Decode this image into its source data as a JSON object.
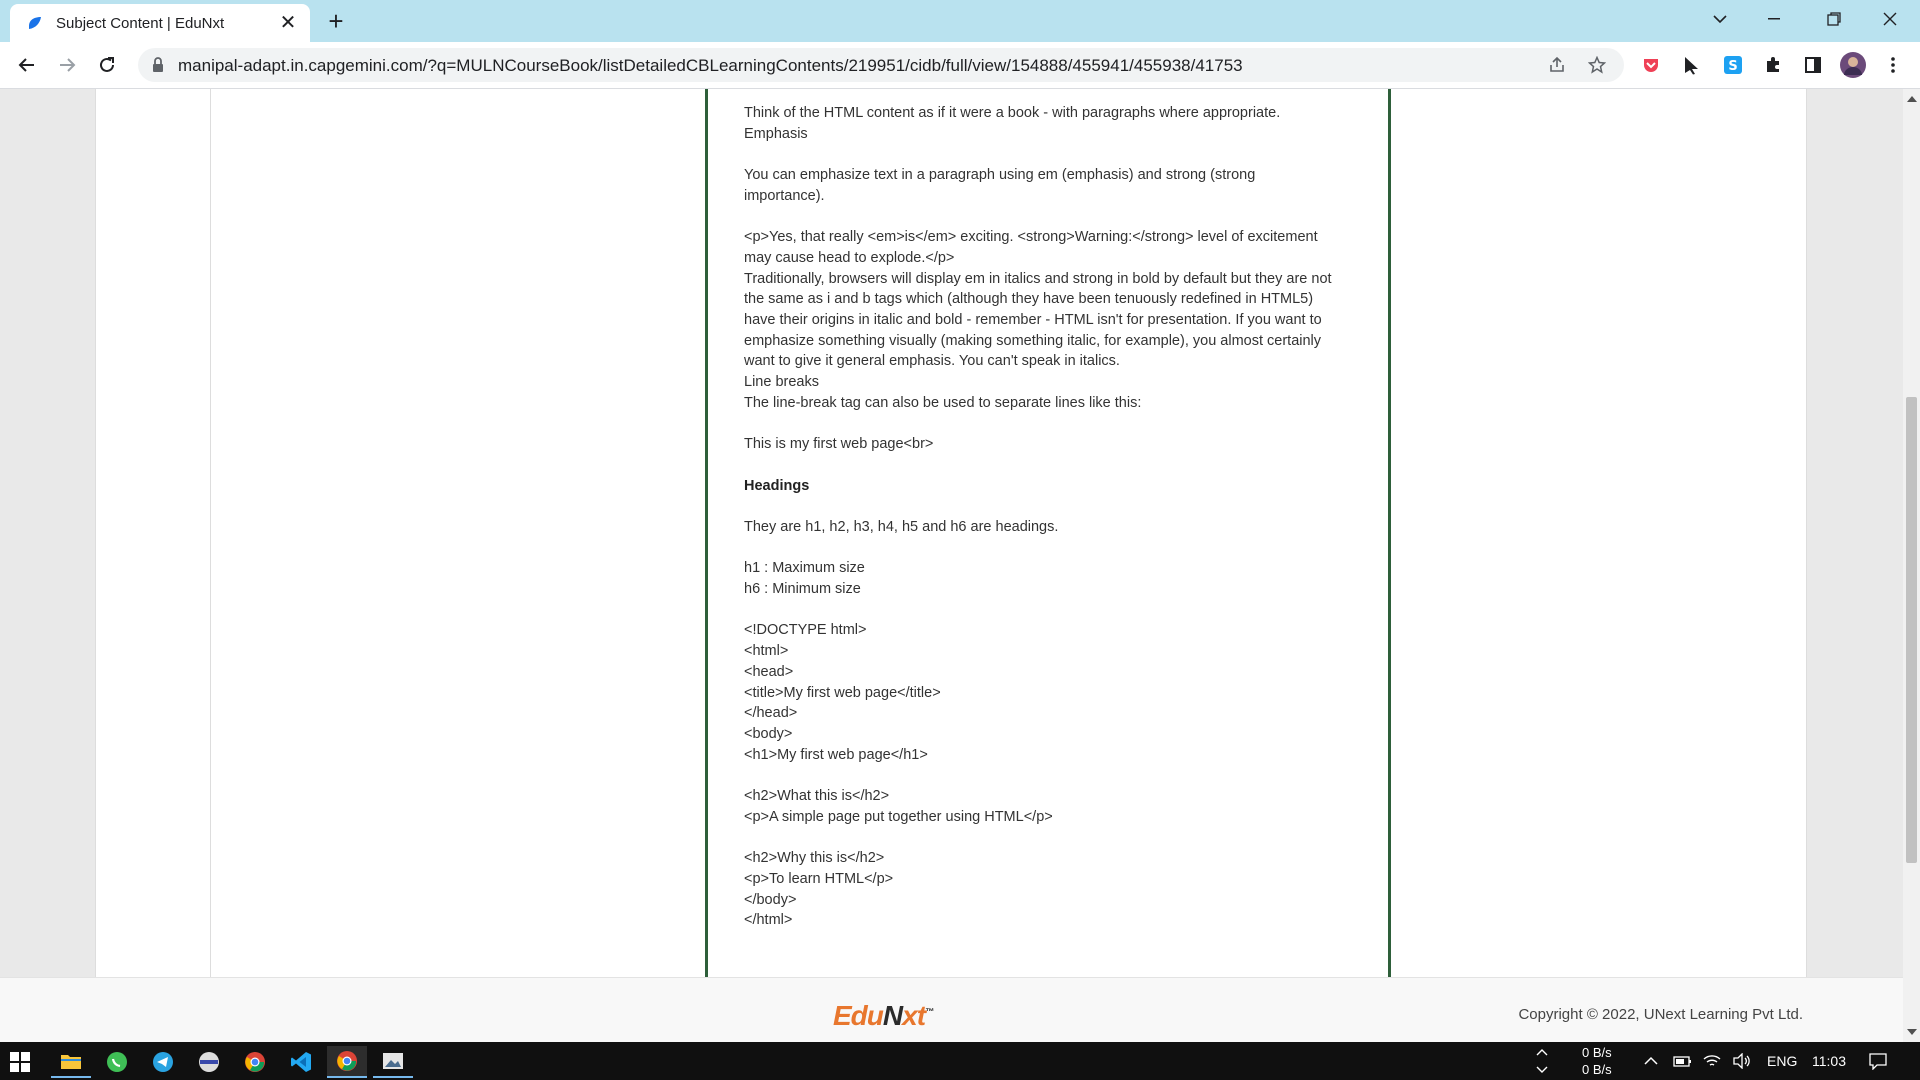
{
  "browser": {
    "tab_title": "Subject Content | EduNxt",
    "url": "manipal-adapt.in.capgemini.com/?q=MULNCourseBook/listDetailedCBLearningContents/219951/cidb/full/view/154888/455941/455938/41753"
  },
  "content": {
    "lines": [
      "Think of the HTML content as if it were a book - with paragraphs where appropriate.",
      "Emphasis",
      "",
      "You can emphasize text in a paragraph using em (emphasis) and strong (strong",
      "importance).",
      "",
      "<p>Yes, that really <em>is</em> exciting. <strong>Warning:</strong> level of excitement",
      "may cause head to explode.</p>",
      "Traditionally, browsers will display em in italics and strong in bold by default but they are not",
      "the same as i and b tags which (although they have been tenuously redefined in HTML5)",
      "have their origins in italic and bold - remember - HTML isn't for presentation. If you want to",
      "emphasize something visually (making something italic, for example), you almost certainly",
      "want to give it general emphasis. You can't speak in italics.",
      "Line breaks",
      "The line-break tag can also be used to separate lines like this:",
      "",
      "This is my first web page<br>",
      ""
    ],
    "heading": "Headings",
    "lines2": [
      "",
      "They are h1, h2, h3, h4, h5 and h6 are headings.",
      "",
      "h1 : Maximum size",
      "h6 : Minimum size",
      "",
      "<!DOCTYPE html>",
      "<html>",
      "<head>",
      "<title>My first web page</title>",
      "</head>",
      "<body>",
      "<h1>My first web page</h1>",
      "",
      "<h2>What this is</h2>",
      "<p>A simple page put together using HTML</p>",
      "",
      "<h2>Why this is</h2>",
      "<p>To learn HTML</p>",
      "</body>",
      "</html>"
    ]
  },
  "footer": {
    "logo_part1": "Edu",
    "logo_part2": "N",
    "logo_part3": "xt",
    "logo_tm": "™",
    "copyright": "Copyright © 2022, UNext Learning Pvt Ltd."
  },
  "taskbar": {
    "net_up": "0 B/s",
    "net_down": "0 B/s",
    "language": "ENG",
    "time": "11:03"
  },
  "colors": {
    "tabstrip": "#b9e2ef",
    "content_border": "#2e5f3a",
    "logo_orange": "#e8772e",
    "logo_dark": "#2b2b2b"
  }
}
